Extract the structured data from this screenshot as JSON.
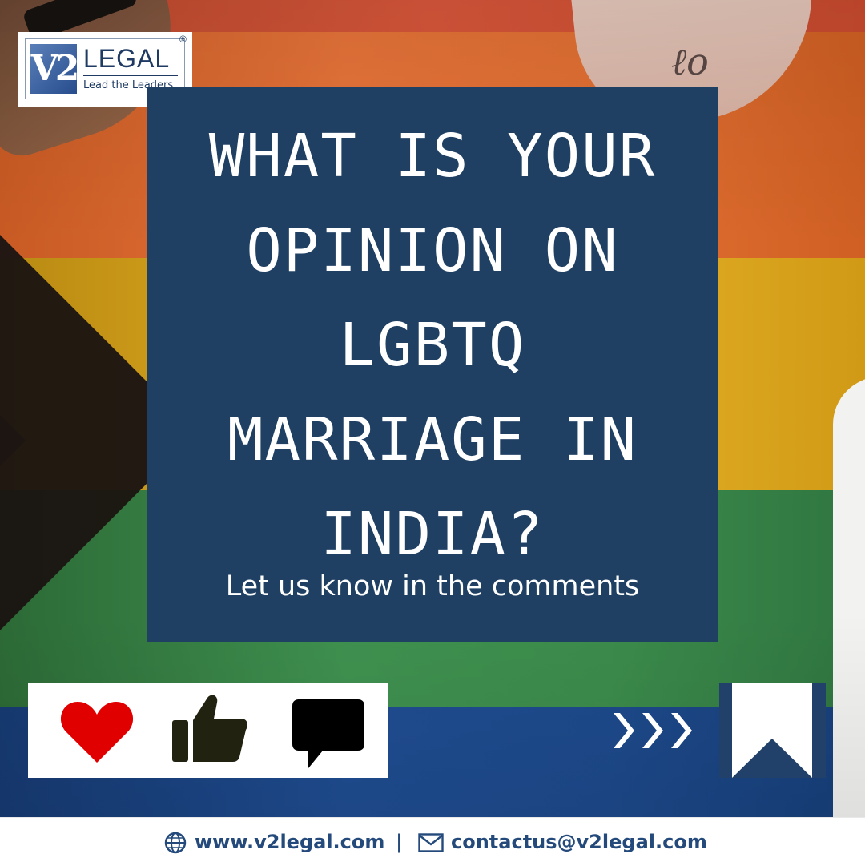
{
  "brand": {
    "logo_mark": "V2",
    "logo_word": "LEGAL",
    "tagline": "Lead the Leaders",
    "registered": "®"
  },
  "card": {
    "headline_lines": [
      "WHAT IS YOUR",
      "OPINION ON",
      "LGBTQ",
      "MARRIAGE IN",
      "INDIA?"
    ],
    "subtext": "Let us know in the comments"
  },
  "reactions": {
    "icons": [
      "heart-icon",
      "thumbs-up-icon",
      "comment-icon"
    ],
    "colors": {
      "heart": "#e00000",
      "thumb": "#222211",
      "comment": "#000000"
    }
  },
  "actions": {
    "icons": [
      "chevrons-right-icon",
      "bookmark-icon"
    ]
  },
  "footer": {
    "website": "www.v2legal.com",
    "separator": "|",
    "email": "contactus@v2legal.com"
  },
  "colors": {
    "card_bg": "#1f4063",
    "brand_blue": "#244a7c",
    "bookmark_bg": "#21416a"
  }
}
